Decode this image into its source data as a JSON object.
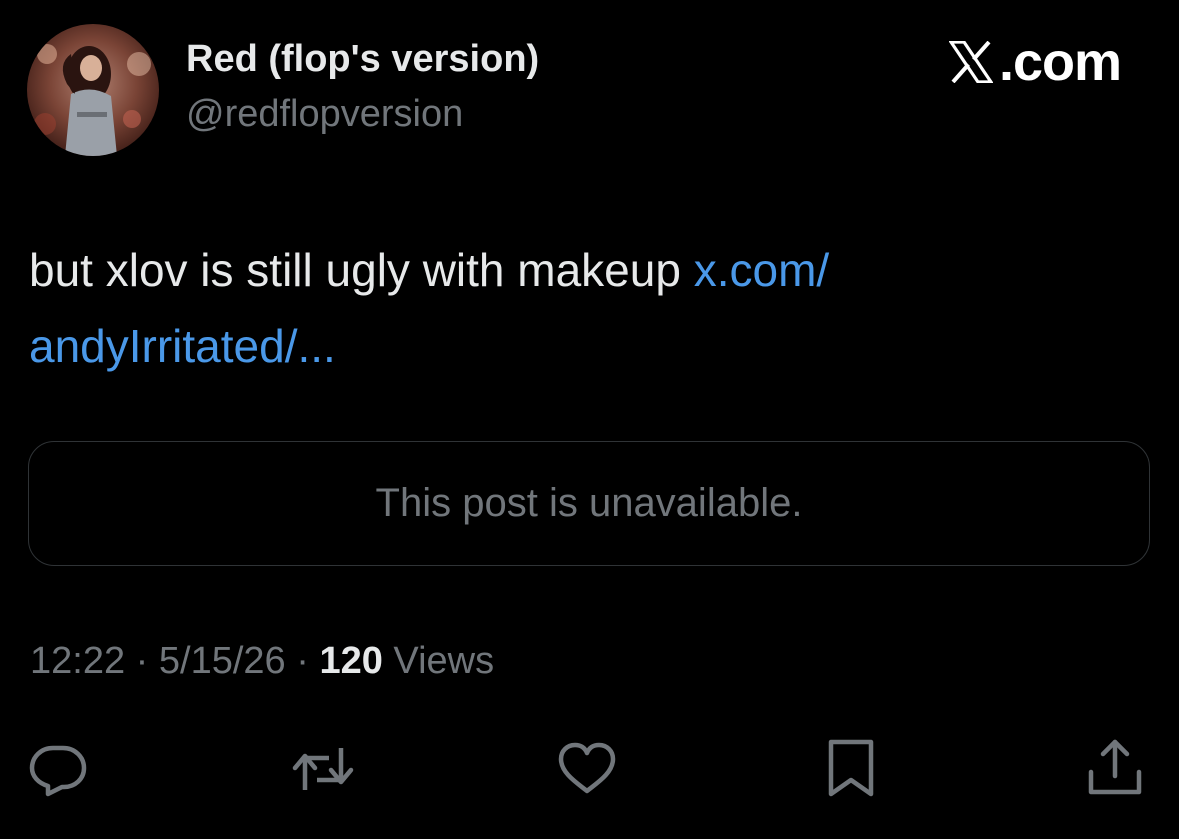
{
  "author": {
    "display_name": "Red (flop's version)",
    "handle": "@redflopversion",
    "avatar": "profile-photo"
  },
  "brand": {
    "icon": "x-logo-icon",
    "text": ".com"
  },
  "post": {
    "text": "but xlov is still ugly with makeup ",
    "link_line1": "x.com/",
    "link_line2": "andyIrritated/..."
  },
  "quote": {
    "text": "This post is unavailable."
  },
  "meta": {
    "time": "12:22",
    "separator": "·",
    "date": "5/15/26",
    "views_count": "120",
    "views_label": "Views"
  },
  "actions": {
    "icons": [
      "reply-icon",
      "repost-icon",
      "like-icon",
      "bookmark-icon",
      "share-icon"
    ]
  },
  "colors": {
    "background": "#000000",
    "text_primary": "#e7e9ea",
    "text_secondary": "#71767b",
    "link": "#4a98e8",
    "border": "#2f3336"
  }
}
